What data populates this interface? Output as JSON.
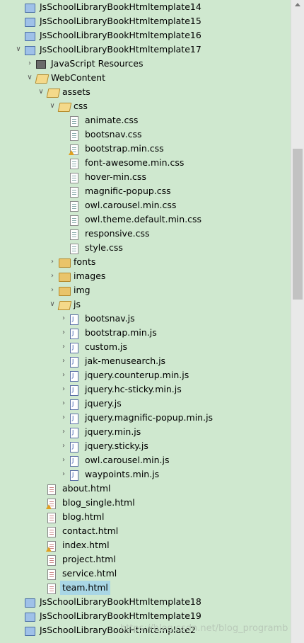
{
  "tree": [
    {
      "label": "JsSchoolLibraryBookHtmltemplate14",
      "depth": 0,
      "kind": "project",
      "twisty": "none"
    },
    {
      "label": "JsSchoolLibraryBookHtmltemplate15",
      "depth": 0,
      "kind": "project",
      "twisty": "none"
    },
    {
      "label": "JsSchoolLibraryBookHtmltemplate16",
      "depth": 0,
      "kind": "project",
      "twisty": "none"
    },
    {
      "label": "JsSchoolLibraryBookHtmltemplate17",
      "depth": 0,
      "kind": "project-open",
      "twisty": "open"
    },
    {
      "label": "JavaScript Resources",
      "depth": 1,
      "kind": "jsres",
      "twisty": "closed"
    },
    {
      "label": "WebContent",
      "depth": 1,
      "kind": "folder-open",
      "twisty": "open"
    },
    {
      "label": "assets",
      "depth": 2,
      "kind": "folder-open",
      "twisty": "open"
    },
    {
      "label": "css",
      "depth": 3,
      "kind": "folder-open",
      "twisty": "open"
    },
    {
      "label": "animate.css",
      "depth": 4,
      "kind": "file",
      "twisty": "none"
    },
    {
      "label": "bootsnav.css",
      "depth": 4,
      "kind": "file",
      "twisty": "none"
    },
    {
      "label": "bootstrap.min.css",
      "depth": 4,
      "kind": "file",
      "twisty": "none",
      "warn": true
    },
    {
      "label": "font-awesome.min.css",
      "depth": 4,
      "kind": "file",
      "twisty": "none"
    },
    {
      "label": "hover-min.css",
      "depth": 4,
      "kind": "file",
      "twisty": "none"
    },
    {
      "label": "magnific-popup.css",
      "depth": 4,
      "kind": "file",
      "twisty": "none"
    },
    {
      "label": "owl.carousel.min.css",
      "depth": 4,
      "kind": "file",
      "twisty": "none"
    },
    {
      "label": "owl.theme.default.min.css",
      "depth": 4,
      "kind": "file",
      "twisty": "none"
    },
    {
      "label": "responsive.css",
      "depth": 4,
      "kind": "file",
      "twisty": "none"
    },
    {
      "label": "style.css",
      "depth": 4,
      "kind": "file",
      "twisty": "none"
    },
    {
      "label": "fonts",
      "depth": 3,
      "kind": "folder",
      "twisty": "closed"
    },
    {
      "label": "images",
      "depth": 3,
      "kind": "folder",
      "twisty": "closed"
    },
    {
      "label": "img",
      "depth": 3,
      "kind": "folder",
      "twisty": "closed"
    },
    {
      "label": "js",
      "depth": 3,
      "kind": "folder-open",
      "twisty": "open"
    },
    {
      "label": "bootsnav.js",
      "depth": 4,
      "kind": "js",
      "twisty": "closed"
    },
    {
      "label": "bootstrap.min.js",
      "depth": 4,
      "kind": "js",
      "twisty": "closed"
    },
    {
      "label": "custom.js",
      "depth": 4,
      "kind": "js",
      "twisty": "closed"
    },
    {
      "label": "jak-menusearch.js",
      "depth": 4,
      "kind": "js",
      "twisty": "closed"
    },
    {
      "label": "jquery.counterup.min.js",
      "depth": 4,
      "kind": "js",
      "twisty": "closed"
    },
    {
      "label": "jquery.hc-sticky.min.js",
      "depth": 4,
      "kind": "js",
      "twisty": "closed"
    },
    {
      "label": "jquery.js",
      "depth": 4,
      "kind": "js",
      "twisty": "closed"
    },
    {
      "label": "jquery.magnific-popup.min.js",
      "depth": 4,
      "kind": "js",
      "twisty": "closed"
    },
    {
      "label": "jquery.min.js",
      "depth": 4,
      "kind": "js",
      "twisty": "closed"
    },
    {
      "label": "jquery.sticky.js",
      "depth": 4,
      "kind": "js",
      "twisty": "closed"
    },
    {
      "label": "owl.carousel.min.js",
      "depth": 4,
      "kind": "js",
      "twisty": "closed"
    },
    {
      "label": "waypoints.min.js",
      "depth": 4,
      "kind": "js",
      "twisty": "closed"
    },
    {
      "label": "about.html",
      "depth": 2,
      "kind": "html",
      "twisty": "none"
    },
    {
      "label": "blog_single.html",
      "depth": 2,
      "kind": "html",
      "twisty": "none",
      "warn": true
    },
    {
      "label": "blog.html",
      "depth": 2,
      "kind": "html",
      "twisty": "none"
    },
    {
      "label": "contact.html",
      "depth": 2,
      "kind": "html",
      "twisty": "none"
    },
    {
      "label": "index.html",
      "depth": 2,
      "kind": "html",
      "twisty": "none",
      "warn": true
    },
    {
      "label": "project.html",
      "depth": 2,
      "kind": "html",
      "twisty": "none"
    },
    {
      "label": "service.html",
      "depth": 2,
      "kind": "html",
      "twisty": "none"
    },
    {
      "label": "team.html",
      "depth": 2,
      "kind": "html",
      "twisty": "none",
      "selected": true
    },
    {
      "label": "JsSchoolLibraryBookHtmltemplate18",
      "depth": 0,
      "kind": "project",
      "twisty": "none"
    },
    {
      "label": "JsSchoolLibraryBookHtmltemplate19",
      "depth": 0,
      "kind": "project",
      "twisty": "none"
    },
    {
      "label": "JsSchoolLibraryBookHtmltemplate2",
      "depth": 0,
      "kind": "project",
      "twisty": "none"
    }
  ],
  "watermark": "https://blog.csdn.net/blog_programb",
  "colors": {
    "background": "#cfe8cf",
    "selection": "#a9d6e5"
  }
}
